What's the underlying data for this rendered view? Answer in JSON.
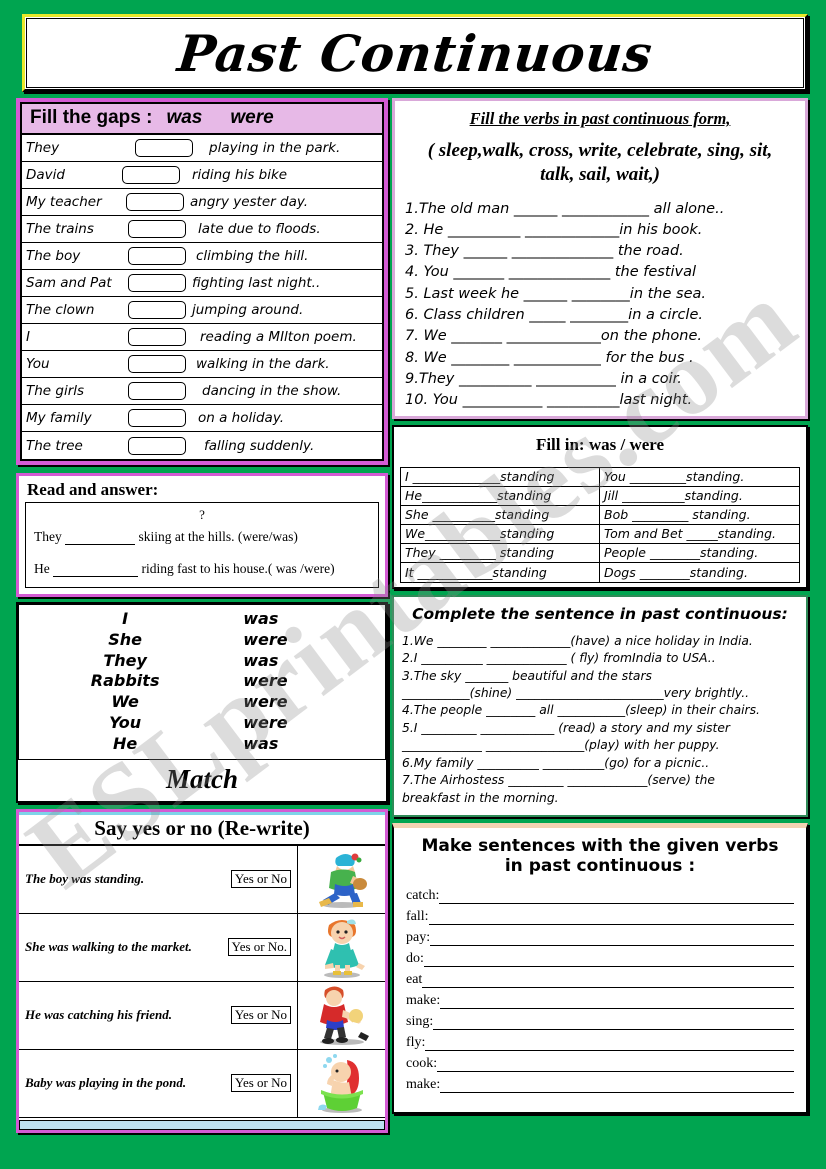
{
  "title": "Past Continuous",
  "watermark": "ESLprintables.com",
  "colors": {
    "page_bg": "#00a550",
    "banner_border": "#e9e92a",
    "magenta_frame": "#d45bd4",
    "pink_header": "#e7b9e7",
    "green_frame": "#2e8b57",
    "peach_bar": "#f2d3b3",
    "blue_bar": "#7fd4e8"
  },
  "left": {
    "fill_gaps": {
      "title_main": "Fill the gaps :",
      "title_word1": "was",
      "title_word2": "were",
      "rows": [
        {
          "subject": "They",
          "tail": "playing in the park."
        },
        {
          "subject": "David",
          "tail": "riding his bike"
        },
        {
          "subject": "My teacher",
          "tail": "angry yester day."
        },
        {
          "subject": "The trains",
          "tail": "late due to floods."
        },
        {
          "subject": "The boy",
          "tail": "climbing the hill."
        },
        {
          "subject": "Sam and Pat",
          "tail": "fighting last night.."
        },
        {
          "subject": "The clown",
          "tail": "jumping  around."
        },
        {
          "subject": "I",
          "tail": "reading a MIlton poem."
        },
        {
          "subject": "You",
          "tail": "walking in the dark."
        },
        {
          "subject": "The  girls",
          "tail": "dancing in the show."
        },
        {
          "subject": "My family",
          "tail": "on a holiday."
        },
        {
          "subject": "The tree",
          "tail": "falling suddenly."
        }
      ]
    },
    "read_answer": {
      "heading": "Read and answer:",
      "question_mark": "?",
      "line1_a": "They",
      "line1_b": "skiing  at the hills. (were/was)",
      "line2_a": "He",
      "line2_b": "riding fast to his house.( was /were)"
    },
    "pronoun_table": {
      "rows": [
        {
          "pronoun": "I",
          "verb": "was"
        },
        {
          "pronoun": "She",
          "verb": "were"
        },
        {
          "pronoun": "They",
          "verb": "was"
        },
        {
          "pronoun": "Rabbits",
          "verb": "were"
        },
        {
          "pronoun": "We",
          "verb": "were"
        },
        {
          "pronoun": "You",
          "verb": "were"
        },
        {
          "pronoun": "He",
          "verb": "was"
        }
      ],
      "match_label": "Match"
    },
    "yes_no": {
      "heading": "Say  yes   or  no (Re-write)",
      "rows": [
        {
          "sentence": "The boy was standing.",
          "choice": "Yes  or  No",
          "image": "running-boy-clipart"
        },
        {
          "sentence": "She was  walking to the market.",
          "choice": "Yes or No.",
          "image": "girl-in-dress-clipart"
        },
        {
          "sentence": "He was catching his friend.",
          "choice": "Yes or No",
          "image": "boy-catching-friend-clipart"
        },
        {
          "sentence": "Baby was playing in the pond.",
          "choice": "Yes or No",
          "image": "baby-in-tub-clipart"
        }
      ]
    }
  },
  "right": {
    "fill_verbs": {
      "heading": "Fill  the verbs in past continuous form,",
      "verbs_line1": "( sleep,walk, cross, write, celebrate, sing, sit,",
      "verbs_line2": "talk, sail, wait,)",
      "questions": [
        "1.The old man  ______  ____________ all alone..",
        "2. He __________    _____________in his book.",
        "3. They ______     ______________ the road.",
        "4. You _______ ______________ the festival",
        "5. Last week he  ______   ________in the sea.",
        "6. Class children  _____  ________in a circle.",
        "7. We _______  _____________on the phone.",
        "8. We ________  ____________ for the bus .",
        "9.They __________ ___________ in a coir.",
        "10. You ___________  __________last night."
      ]
    },
    "fill_was_were": {
      "heading": "Fill  in:  was / were",
      "left_column": [
        "I ______________standing",
        "He____________standing",
        "She __________standing",
        "We____________standing",
        "They _________ standing",
        "It ____________standing"
      ],
      "right_column": [
        "You _________standing.",
        "Jill __________standing.",
        "Bob _________ standing.",
        "Tom and Bet _____standing.",
        "People ________standing.",
        "Dogs ________standing."
      ]
    },
    "complete_sentence": {
      "heading": "Complete the sentence  in past continuous:",
      "lines": [
        "1.We ________  _____________(have) a nice holiday in India.",
        "2.I __________  _____________ ( fly) fromIndia to USA..",
        "3.The sky _______ beautiful and the stars",
        "___________(shine) ________________________very brightly..",
        "4.The people ________  all  ___________(sleep) in their chairs.",
        "5.I _________   ____________ (read) a story and my sister",
        "_____________  ________________(play) with her puppy.",
        "6.My family  __________  __________(go) for a picnic..",
        "7.The Airhostess _________  _____________(serve) the",
        "breakfast  in the morning."
      ]
    },
    "make_sentences": {
      "heading_line1": "Make sentences with the given verbs",
      "heading_line2": "in past  continuous :",
      "verbs": [
        "catch:",
        "fall:",
        "pay:",
        "do:",
        "eat",
        "make:",
        "sing:",
        "fly:",
        "cook:",
        "make:"
      ]
    }
  }
}
